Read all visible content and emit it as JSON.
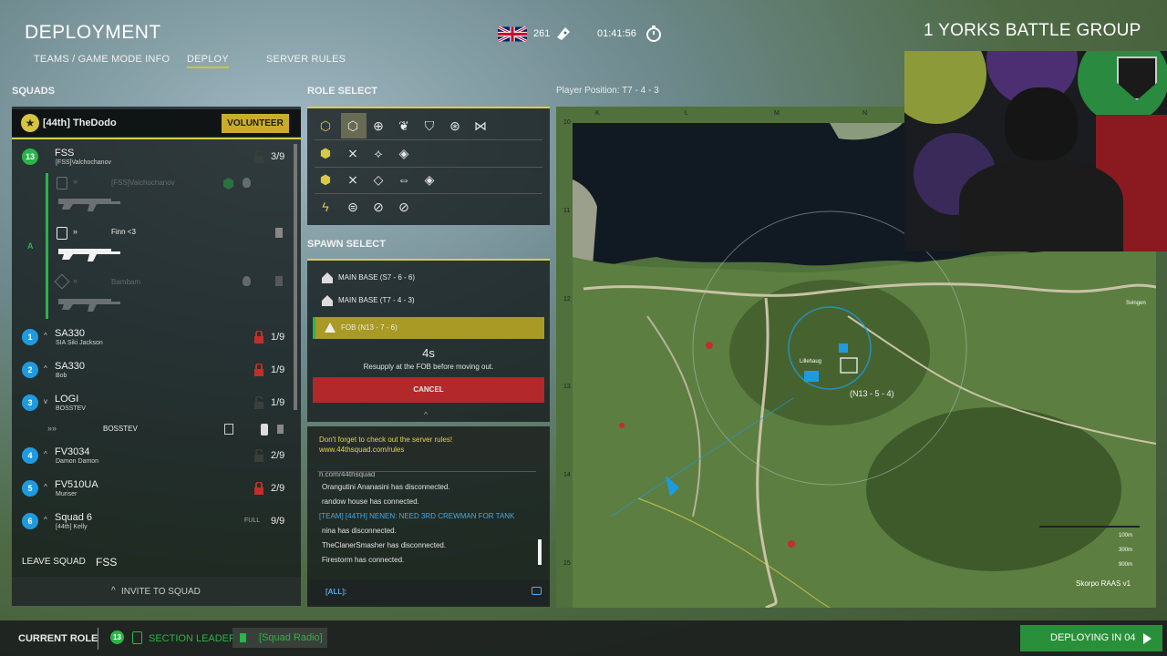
{
  "header": {
    "title": "DEPLOYMENT",
    "tabs": [
      {
        "label": "TEAMS / GAME MODE INFO"
      },
      {
        "label": "DEPLOY"
      },
      {
        "label": "SERVER RULES"
      }
    ],
    "ticket_count": "261",
    "timer": "01:41:56",
    "group_name": "1 YORKS BATTLE GROUP"
  },
  "squads": {
    "heading": "SQUADS",
    "leader": {
      "name": "[44th] TheDodo",
      "button": "VOLUNTEER"
    },
    "fss": {
      "number": "13",
      "name": "FSS",
      "leader": "[FSS]Valchochanov",
      "count": "3/9",
      "members": [
        {
          "name": "[FSS]Valchochanov"
        },
        {
          "name": "Finn <3"
        },
        {
          "name": "Bambam"
        }
      ],
      "fireteam": "A"
    },
    "list": [
      {
        "number": "1",
        "name": "SA330",
        "leader": "SIA Siki Jackson",
        "count": "1/9",
        "locked": true
      },
      {
        "number": "2",
        "name": "SA330",
        "leader": "Bob",
        "count": "1/9",
        "locked": true
      },
      {
        "number": "3",
        "name": "LOGI",
        "leader": "BOSSTEV",
        "count": "1/9",
        "locked": false
      },
      {
        "number": "4",
        "name": "FV3034",
        "leader": "Damon Damon",
        "count": "2/9",
        "locked": false
      },
      {
        "number": "5",
        "name": "FV510UA",
        "leader": "Muriser",
        "count": "2/9",
        "locked": true
      },
      {
        "number": "6",
        "name": "Squad 6",
        "leader": "[44th] Kelly",
        "count": "9/9",
        "full": "FULL"
      }
    ],
    "logi_member": "BOSSTEV",
    "leave_label": "LEAVE SQUAD",
    "current_squad": "FSS",
    "invite_label": "INVITE TO SQUAD"
  },
  "role_select": {
    "heading": "ROLE SELECT"
  },
  "spawn_select": {
    "heading": "SPAWN SELECT",
    "options": [
      {
        "label": "MAIN BASE (S7 - 6 - 6)"
      },
      {
        "label": "MAIN BASE (T7 - 4 - 3)"
      },
      {
        "label": "FOB (N13 - 7 - 6)"
      }
    ],
    "countdown": "4s",
    "message": "Resupply at the FOB before moving out.",
    "cancel": "CANCEL"
  },
  "chat": {
    "notice_1": "Don't forget to check out the server rules!",
    "notice_2": "www.44thsquad.com/rules",
    "lines": [
      {
        "text": "h.com/44thsquad"
      },
      {
        "text": "Orangutini Ananasini has disconnected."
      },
      {
        "text": "randow house has connected."
      },
      {
        "text": "[TEAM] [44TH] NENEN: NEED 3RD CREWMAN FOR TANK"
      },
      {
        "text": "nina has disconnected."
      },
      {
        "text": "TheClanerSmasher has disconnected."
      },
      {
        "text": "Firestorm has connected."
      }
    ],
    "channel": "[ALL]:"
  },
  "map": {
    "player_position": "Player Position: T7 - 4 - 3",
    "columns": [
      "K",
      "L",
      "M",
      "N"
    ],
    "rows": [
      "10",
      "11",
      "12",
      "13",
      "14",
      "15"
    ],
    "marker": "(N13 - 5 - 4)",
    "town_1": "Lillehaug",
    "town_2": "Svingen",
    "scale": [
      "100m",
      "300m",
      "900m"
    ],
    "map_name": "Skorpo RAAS v1"
  },
  "footer": {
    "current_role_label": "CURRENT ROLE",
    "squad_number": "13",
    "role": "SECTION LEADER",
    "radio": "[Squad Radio]",
    "deploy": "DEPLOYING IN 04"
  },
  "colors": {
    "accent": "#d6d04a",
    "blue": "#1e9be0",
    "green": "#2ab44a",
    "red": "#c0302a"
  }
}
